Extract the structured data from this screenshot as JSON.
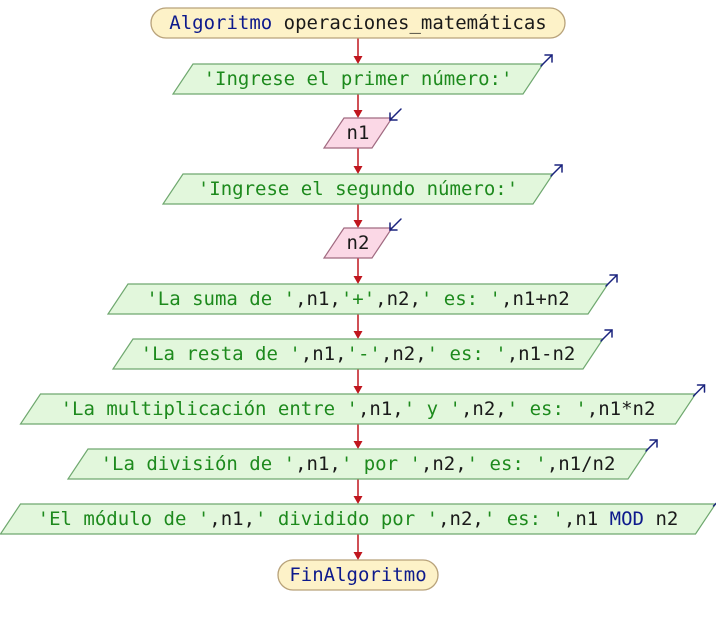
{
  "colors": {
    "terminal_fill": "#fdf2c8",
    "terminal_stroke": "#b8a27a",
    "output_fill": "#e2f7dc",
    "output_stroke": "#6fa86f",
    "input_fill": "#fbd8e6",
    "input_stroke": "#a06a80",
    "arrow": "#c0161e",
    "keyword": "#0d1a8c",
    "string": "#1d8a1d",
    "identifier": "#1a1a1a",
    "io_arrow": "#1a237e"
  },
  "nodes": [
    {
      "kind": "terminal",
      "tokens": [
        {
          "t": "Algoritmo",
          "c": "keyword"
        },
        {
          "t": " operaciones_matemáticas",
          "c": "identifier"
        }
      ]
    },
    {
      "kind": "output",
      "tokens": [
        {
          "t": "'Ingrese el primer número:'",
          "c": "string"
        }
      ]
    },
    {
      "kind": "input",
      "tokens": [
        {
          "t": "n1",
          "c": "identifier"
        }
      ]
    },
    {
      "kind": "output",
      "tokens": [
        {
          "t": "'Ingrese el segundo número:'",
          "c": "string"
        }
      ]
    },
    {
      "kind": "input",
      "tokens": [
        {
          "t": "n2",
          "c": "identifier"
        }
      ]
    },
    {
      "kind": "output",
      "tokens": [
        {
          "t": "'La suma de '",
          "c": "string"
        },
        {
          "t": ",n1,",
          "c": "identifier"
        },
        {
          "t": "'+'",
          "c": "string"
        },
        {
          "t": ",n2,",
          "c": "identifier"
        },
        {
          "t": "' es: '",
          "c": "string"
        },
        {
          "t": ",n1+n2",
          "c": "identifier"
        }
      ]
    },
    {
      "kind": "output",
      "tokens": [
        {
          "t": "'La resta de '",
          "c": "string"
        },
        {
          "t": ",n1,",
          "c": "identifier"
        },
        {
          "t": "'-'",
          "c": "string"
        },
        {
          "t": ",n2,",
          "c": "identifier"
        },
        {
          "t": "' es: '",
          "c": "string"
        },
        {
          "t": ",n1-n2",
          "c": "identifier"
        }
      ]
    },
    {
      "kind": "output",
      "tokens": [
        {
          "t": "'La multiplicación entre '",
          "c": "string"
        },
        {
          "t": ",n1,",
          "c": "identifier"
        },
        {
          "t": "' y '",
          "c": "string"
        },
        {
          "t": ",n2,",
          "c": "identifier"
        },
        {
          "t": "' es: '",
          "c": "string"
        },
        {
          "t": ",n1*n2",
          "c": "identifier"
        }
      ]
    },
    {
      "kind": "output",
      "tokens": [
        {
          "t": "'La división de '",
          "c": "string"
        },
        {
          "t": ",n1,",
          "c": "identifier"
        },
        {
          "t": "' por '",
          "c": "string"
        },
        {
          "t": ",n2,",
          "c": "identifier"
        },
        {
          "t": "' es: '",
          "c": "string"
        },
        {
          "t": ",n1/n2",
          "c": "identifier"
        }
      ]
    },
    {
      "kind": "output",
      "tokens": [
        {
          "t": "'El módulo de '",
          "c": "string"
        },
        {
          "t": ",n1,",
          "c": "identifier"
        },
        {
          "t": "' dividido por '",
          "c": "string"
        },
        {
          "t": ",n2,",
          "c": "identifier"
        },
        {
          "t": "' es: '",
          "c": "string"
        },
        {
          "t": ",n1 ",
          "c": "identifier"
        },
        {
          "t": "MOD",
          "c": "keyword"
        },
        {
          "t": " n2",
          "c": "identifier"
        }
      ]
    },
    {
      "kind": "terminal",
      "tokens": [
        {
          "t": "FinAlgoritmo",
          "c": "keyword"
        }
      ]
    }
  ]
}
